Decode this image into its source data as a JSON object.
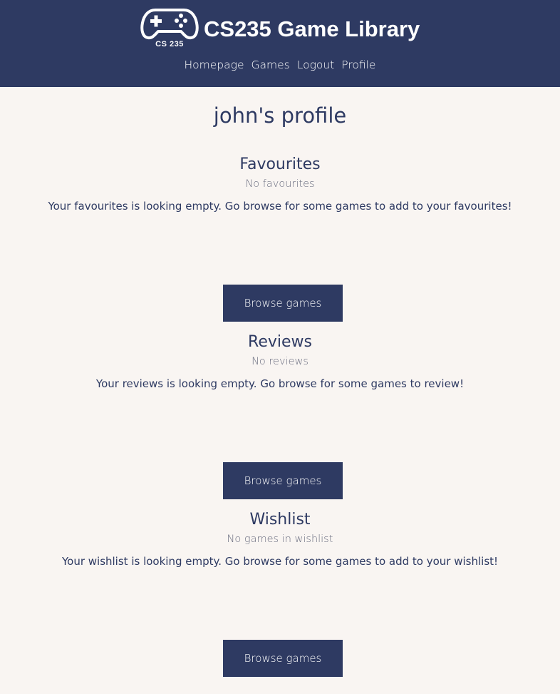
{
  "header": {
    "logo_caption": "CS 235",
    "site_title": "CS235 Game Library",
    "nav": [
      "Homepage",
      "Games",
      "Logout",
      "Profile"
    ]
  },
  "profile": {
    "title": "john's profile"
  },
  "sections": [
    {
      "heading": "Favourites",
      "empty_text": "No favourites",
      "hint": "Your favourites is looking empty. Go browse for some games to add to your favourites!",
      "button_label": "Browse games"
    },
    {
      "heading": "Reviews",
      "empty_text": "No reviews",
      "hint": "Your reviews is looking empty. Go browse for some games to review!",
      "button_label": "Browse games"
    },
    {
      "heading": "Wishlist",
      "empty_text": "No games in wishlist",
      "hint": "Your wishlist is looking empty. Go browse for some games to add to your wishlist!",
      "button_label": "Browse games"
    }
  ],
  "colors": {
    "header_bg": "#2e3a62",
    "page_bg": "#f9f5f2",
    "button_bg": "#2e3a62"
  },
  "icons": {
    "logo": "game-controller-icon"
  }
}
